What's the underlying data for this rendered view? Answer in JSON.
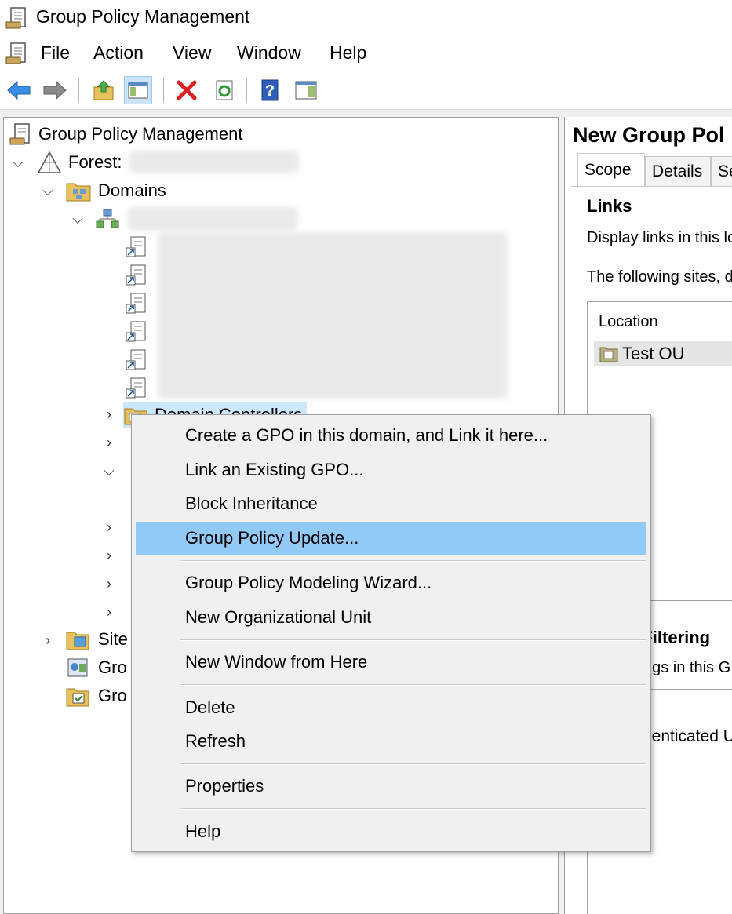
{
  "window": {
    "title": "Group Policy Management"
  },
  "menubar": [
    "File",
    "Action",
    "View",
    "Window",
    "Help"
  ],
  "toolbar": {
    "buttons": [
      "back-arrow-icon",
      "forward-arrow-icon",
      "up-folder-icon",
      "show-hide-tree-icon",
      "delete-icon",
      "refresh-icon",
      "help-icon",
      "action-pane-icon"
    ]
  },
  "tree": {
    "root": "Group Policy Management",
    "forest_label": "Forest:",
    "domains": "Domains",
    "domain_controllers": "Domain Controllers",
    "sites": "Site",
    "gpm_item1": "Gro",
    "gpm_item2": "Gro"
  },
  "right_pane": {
    "title": "New Group Pol",
    "tabs": [
      "Scope",
      "Details",
      "Se"
    ],
    "links_heading": "Links",
    "display_links": "Display links in this lo",
    "following_sites": "The following sites, d",
    "location_header": "Location",
    "location_value": "Test OU",
    "filtering_heading": "y Filtering",
    "filtering_text": "ngs in this G",
    "authenticated": "nenticated U"
  },
  "context_menu": {
    "items": [
      "Create a GPO in this domain, and Link it here...",
      "Link an Existing GPO...",
      "Block Inheritance",
      "Group Policy Update...",
      "Group Policy Modeling Wizard...",
      "New Organizational Unit",
      "New Window from Here",
      "Delete",
      "Refresh",
      "Properties",
      "Help"
    ],
    "highlighted": "Group Policy Update..."
  },
  "colors": {
    "highlight": "#91c9f7",
    "menu_bg": "#f0f0f0"
  }
}
